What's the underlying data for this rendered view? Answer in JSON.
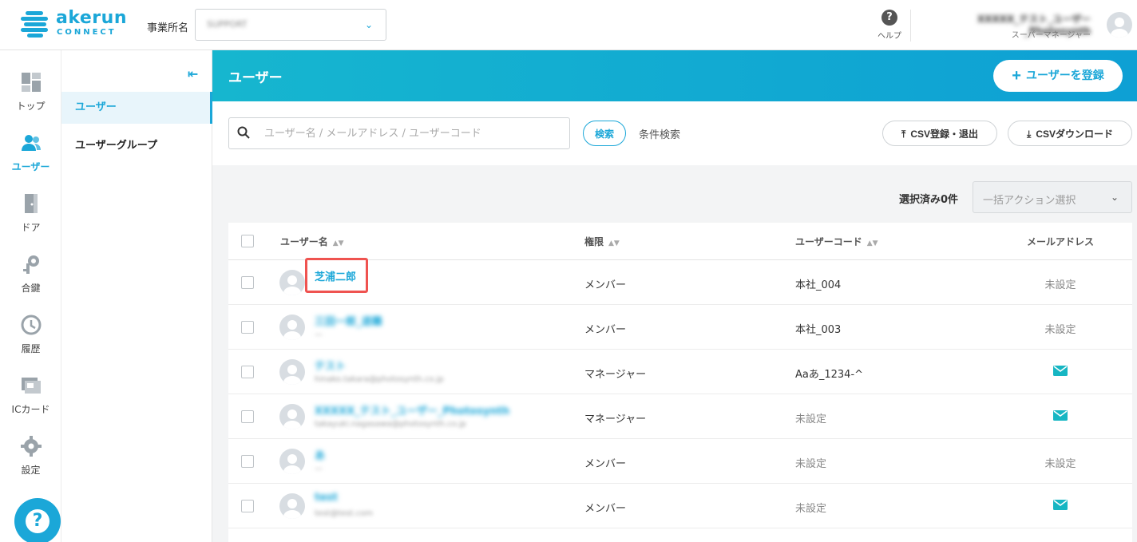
{
  "header": {
    "logo_word": "akerun",
    "logo_sub": "CONNECT",
    "office_label": "事業所名",
    "office_value": "SUPPORT",
    "help_label": "ヘルプ",
    "user_name": "XXXXX_テスト_ユーザー_Photosynth",
    "user_role": "スーパーマネージャー"
  },
  "leftnav": {
    "items": [
      {
        "label": "トップ",
        "icon": "dashboard-icon"
      },
      {
        "label": "ユーザー",
        "icon": "users-icon"
      },
      {
        "label": "ドア",
        "icon": "door-icon"
      },
      {
        "label": "合鍵",
        "icon": "key-icon"
      },
      {
        "label": "履歴",
        "icon": "history-icon"
      },
      {
        "label": "ICカード",
        "icon": "ic-card-icon"
      },
      {
        "label": "設定",
        "icon": "gear-icon"
      }
    ],
    "help_fab": "?"
  },
  "subnav": {
    "items": [
      {
        "label": "ユーザー"
      },
      {
        "label": "ユーザーグループ"
      }
    ]
  },
  "banner": {
    "title": "ユーザー",
    "add_user_label": "ユーザーを登録"
  },
  "search": {
    "placeholder": "ユーザー名 / メールアドレス / ユーザーコード",
    "search_label": "検索",
    "condition_label": "条件検索",
    "csv_import_label": "CSV登録・退出",
    "csv_download_label": "CSVダウンロード"
  },
  "bulk": {
    "selected_label": "選択済み0件",
    "action_placeholder": "一括アクション選択"
  },
  "table": {
    "headers": {
      "name": "ユーザー名",
      "role": "権限",
      "code": "ユーザーコード",
      "email": "メールアドレス"
    },
    "rows": [
      {
        "name": "芝浦二郎",
        "email": "",
        "role": "メンバー",
        "code": "本社_004",
        "mail": "未設定",
        "blur": false
      },
      {
        "name": "三田一郎_退職",
        "email": "—",
        "role": "メンバー",
        "code": "本社_003",
        "mail": "未設定",
        "blur": true
      },
      {
        "name": "テスト",
        "email": "hinako.takara@photosynth.co.jp",
        "role": "マネージャー",
        "code": "Aaあ_1234-^",
        "mail": "icon",
        "blur": true
      },
      {
        "name": "XXXXX_テスト_ユーザー_Photosynth",
        "email": "takayuki.nagasawa@photosynth.co.jp",
        "role": "マネージャー",
        "code": "未設定",
        "mail": "icon",
        "blur": true
      },
      {
        "name": "あ",
        "email": "—",
        "role": "メンバー",
        "code": "未設定",
        "mail": "未設定",
        "blur": true
      },
      {
        "name": "test",
        "email": "test@test.com",
        "role": "メンバー",
        "code": "未設定",
        "mail": "icon",
        "blur": true
      }
    ]
  },
  "colors": {
    "accent": "#1ba7d8",
    "mail_icon": "#16b6c3",
    "highlight": "#ef5350"
  }
}
